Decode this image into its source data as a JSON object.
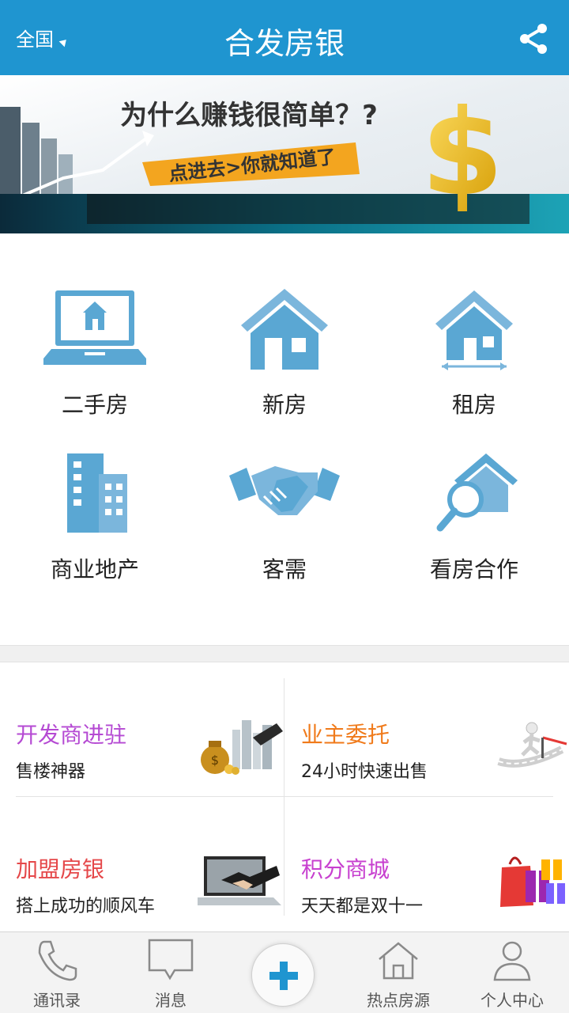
{
  "header": {
    "region": "全国",
    "title": "合发房银"
  },
  "banner": {
    "headline": "为什么赚钱很简单？?",
    "cta": "点进去>你就知道了"
  },
  "grid": {
    "items": [
      {
        "label": "二手房",
        "icon": "laptop-house-icon"
      },
      {
        "label": "新房",
        "icon": "house-icon"
      },
      {
        "label": "租房",
        "icon": "house-measure-icon"
      },
      {
        "label": "商业地产",
        "icon": "office-building-icon"
      },
      {
        "label": "客需",
        "icon": "handshake-icon"
      },
      {
        "label": "看房合作",
        "icon": "house-search-icon"
      }
    ]
  },
  "promos": {
    "items": [
      {
        "title": "开发商进驻",
        "subtitle": "售楼神器",
        "color": "#b54ad3"
      },
      {
        "title": "业主委托",
        "subtitle": "24小时快速出售",
        "color": "#f07a1a"
      },
      {
        "title": "加盟房银",
        "subtitle": "搭上成功的顺风车",
        "color": "#e5484a"
      },
      {
        "title": "积分商城",
        "subtitle": "天天都是双十一",
        "color": "#c73fcf"
      }
    ]
  },
  "tabbar": {
    "items": [
      {
        "label": "通讯录",
        "icon": "phone-icon"
      },
      {
        "label": "消息",
        "icon": "message-icon"
      },
      {
        "label": "",
        "icon": "plus-icon"
      },
      {
        "label": "热点房源",
        "icon": "home-icon"
      },
      {
        "label": "个人中心",
        "icon": "person-icon"
      }
    ]
  },
  "colors": {
    "primary": "#1f95d0",
    "icon_blue": "#5aa7d3"
  }
}
